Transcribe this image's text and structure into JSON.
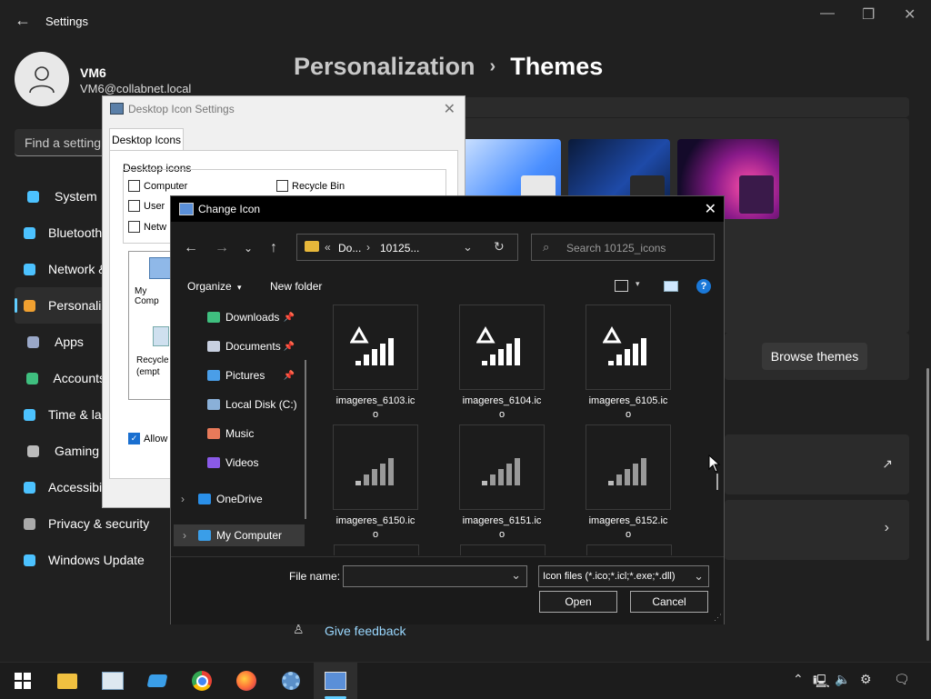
{
  "settings": {
    "title": "Settings",
    "user": {
      "name": "VM6",
      "email": "VM6@collabnet.local"
    },
    "breadcrumb": {
      "parent": "Personalization",
      "separator": "›",
      "current": "Themes"
    },
    "search_placeholder": "Find a setting",
    "nav": [
      {
        "label": "System",
        "icon": "monitor-icon",
        "color": "#4cc2ff"
      },
      {
        "label": "Bluetooth & devices",
        "icon": "bluetooth-icon",
        "color": "#4cc2ff"
      },
      {
        "label": "Network & internet",
        "icon": "wifi-icon",
        "color": "#4cc2ff"
      },
      {
        "label": "Personalization",
        "icon": "brush-icon",
        "color": "#f0a030"
      },
      {
        "label": "Apps",
        "icon": "apps-icon",
        "color": "#9aa8c8"
      },
      {
        "label": "Accounts",
        "icon": "person-icon",
        "color": "#3fbf7f"
      },
      {
        "label": "Time & language",
        "icon": "clock-icon",
        "color": "#4cc2ff"
      },
      {
        "label": "Gaming",
        "icon": "gamepad-icon",
        "color": "#bbbbbb"
      },
      {
        "label": "Accessibility",
        "icon": "accessibility-icon",
        "color": "#4cc2ff"
      },
      {
        "label": "Privacy & security",
        "icon": "shield-icon",
        "color": "#aaaaaa"
      },
      {
        "label": "Windows Update",
        "icon": "update-icon",
        "color": "#4cc2ff"
      }
    ],
    "browse_themes": "Browse themes",
    "give_feedback": "Give feedback"
  },
  "desktop_icon_settings": {
    "title": "Desktop Icon Settings",
    "tab": "Desktop Icons",
    "group": "Desktop icons",
    "checkboxes": [
      "Computer",
      "User",
      "Netw",
      "Recycle Bin"
    ],
    "icons": [
      "My Comp",
      "Recycle",
      "(empt"
    ],
    "allow_label": "Allow t"
  },
  "change_icon": {
    "title": "Change Icon",
    "address": {
      "prefix": "«",
      "segment1": "Do...",
      "sep": "›",
      "segment2": "10125..."
    },
    "search_placeholder": "Search 10125_icons",
    "toolbar": {
      "organize": "Organize",
      "new_folder": "New folder"
    },
    "tree": [
      {
        "label": "Downloads",
        "icon": "download-icon",
        "pinned": true
      },
      {
        "label": "Documents",
        "icon": "document-icon",
        "pinned": true
      },
      {
        "label": "Pictures",
        "icon": "pictures-icon",
        "pinned": true
      },
      {
        "label": "Local Disk (C:)",
        "icon": "drive-icon",
        "pinned": false
      },
      {
        "label": "Music",
        "icon": "music-icon",
        "pinned": false
      },
      {
        "label": "Videos",
        "icon": "videos-icon",
        "pinned": false
      },
      {
        "label": "OneDrive",
        "icon": "cloud-icon",
        "pinned": false
      },
      {
        "label": "My Computer",
        "icon": "computer-icon",
        "pinned": false
      }
    ],
    "files": [
      {
        "name": "imageres_6103.ico",
        "warning": true
      },
      {
        "name": "imageres_6104.ico",
        "warning": true
      },
      {
        "name": "imageres_6105.ico",
        "warning": true
      },
      {
        "name": "imageres_6150.ico",
        "warning": false
      },
      {
        "name": "imageres_6151.ico",
        "warning": false
      },
      {
        "name": "imageres_6152.ico",
        "warning": false
      }
    ],
    "file_name_label": "File name:",
    "file_name_value": "",
    "filter": "Icon files (*.ico;*.icl;*.exe;*.dll)",
    "open": "Open",
    "cancel": "Cancel"
  }
}
